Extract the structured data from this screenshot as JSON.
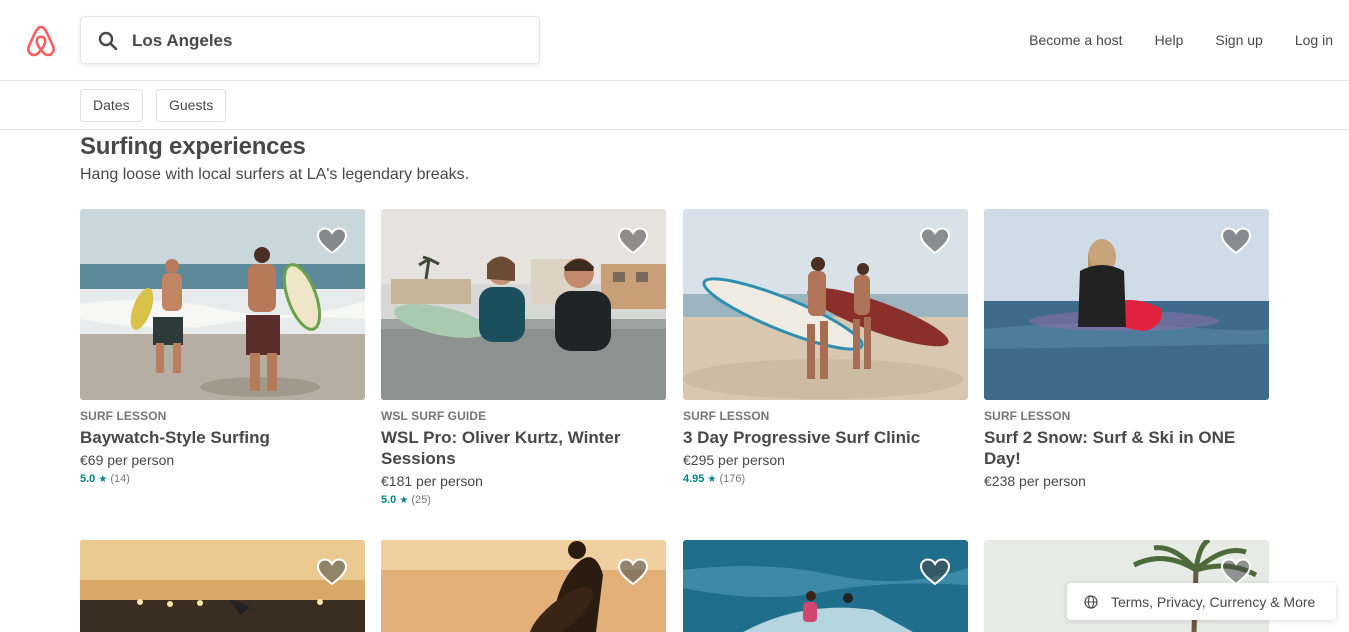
{
  "header": {
    "logo": "airbnb-belo-logo",
    "search_value": "Los Angeles",
    "nav": [
      "Become a host",
      "Help",
      "Sign up",
      "Log in"
    ]
  },
  "filters": [
    "Dates",
    "Guests"
  ],
  "section": {
    "title": "Surfing experiences",
    "subtitle": "Hang loose with local surfers at LA's legendary breaks."
  },
  "cards": [
    {
      "category": "SURF LESSON",
      "title": "Baywatch-Style Surfing",
      "price": "€69 per person",
      "rating": "5.0",
      "reviews": "(14)"
    },
    {
      "category": "WSL SURF GUIDE",
      "title": "WSL Pro: Oliver Kurtz, Winter Sessions",
      "price": "€181 per person",
      "rating": "5.0",
      "reviews": "(25)"
    },
    {
      "category": "SURF LESSON",
      "title": "3 Day Progressive Surf Clinic",
      "price": "€295 per person",
      "rating": "4.95",
      "reviews": "(176)"
    },
    {
      "category": "SURF LESSON",
      "title": "Surf 2 Snow: Surf & Ski in ONE Day!",
      "price": "€238 per person",
      "rating": "",
      "reviews": ""
    }
  ],
  "footer": {
    "label": "Terms, Privacy, Currency & More",
    "icon": "globe-icon"
  },
  "colors": {
    "brand": "#FF5A5F",
    "accent": "#008489",
    "text": "#484848",
    "muted": "#767676"
  }
}
